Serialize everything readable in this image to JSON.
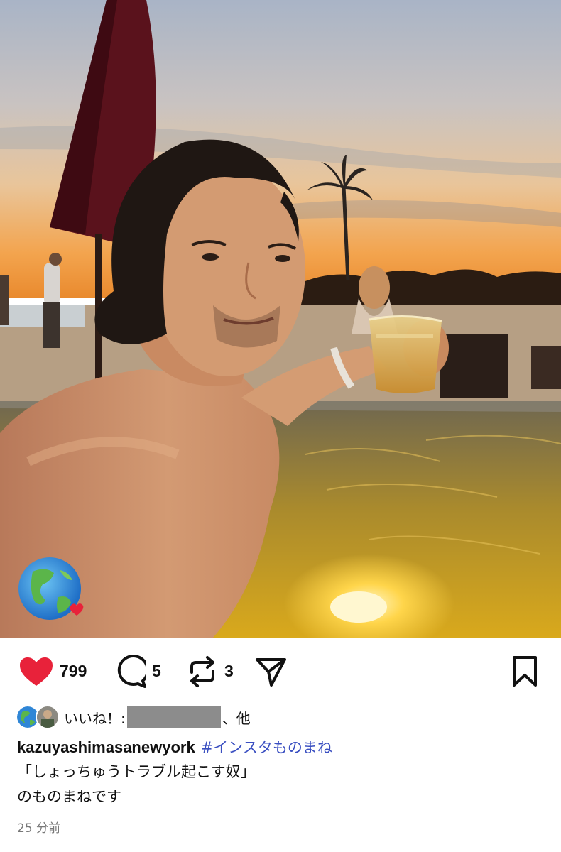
{
  "post": {
    "like_count": "799",
    "comment_count": "5",
    "repost_count": "3",
    "likes_prefix": "いいね！:",
    "likes_suffix": "、他",
    "username": "kazuyashimasanewyork",
    "hashtag": "#インスタものまね",
    "caption_line1": "「しょっちゅうトラブル起こす奴」",
    "caption_line2": "のものまねです",
    "timestamp": "25 分前"
  },
  "icons": {
    "like": "heart-filled-icon",
    "comment": "speech-bubble-icon",
    "repost": "repost-arrows-icon",
    "share": "paper-plane-icon",
    "save": "bookmark-icon",
    "badge": "earth-globe-icon"
  },
  "colors": {
    "heart": "#e8223a",
    "hashtag": "#3a4fc1",
    "timestamp": "#777777",
    "redaction": "#8c8c8c"
  }
}
